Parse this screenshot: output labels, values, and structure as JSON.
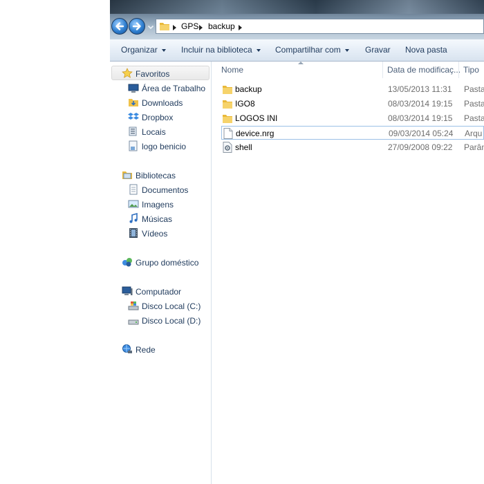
{
  "address_bar": {
    "breadcrumbs": [
      "GPS",
      "backup"
    ]
  },
  "toolbar": {
    "organize": "Organizar",
    "include_library": "Incluir na biblioteca",
    "share": "Compartilhar com",
    "burn": "Gravar",
    "new_folder": "Nova pasta"
  },
  "sidebar": {
    "favorites": {
      "label": "Favoritos",
      "items": [
        "Área de Trabalho",
        "Downloads",
        "Dropbox",
        "Locais",
        "logo benicio"
      ]
    },
    "libraries": {
      "label": "Bibliotecas",
      "items": [
        "Documentos",
        "Imagens",
        "Músicas",
        "Vídeos"
      ]
    },
    "homegroup": "Grupo doméstico",
    "computer": {
      "label": "Computador",
      "items": [
        "Disco Local (C:)",
        "Disco Local (D:)"
      ]
    },
    "network": "Rede"
  },
  "columns": {
    "name": "Nome",
    "date": "Data de modificaç...",
    "type": "Tipo"
  },
  "files": [
    {
      "name": "backup",
      "date": "13/05/2013 11:31",
      "type": "Pasta",
      "icon": "folder-icon"
    },
    {
      "name": "IGO8",
      "date": "08/03/2014 19:15",
      "type": "Pasta",
      "icon": "folder-icon"
    },
    {
      "name": "LOGOS INI",
      "date": "08/03/2014 19:15",
      "type": "Pasta",
      "icon": "folder-icon"
    },
    {
      "name": "device.nrg",
      "date": "09/03/2014 05:24",
      "type": "Arqu",
      "icon": "document-icon",
      "selected": true
    },
    {
      "name": "shell",
      "date": "27/09/2008 09:22",
      "type": "Parâm",
      "icon": "settings-file-icon"
    }
  ],
  "colors": {
    "text_blue": "#1e395b",
    "folder_yellow": "#f0c24a",
    "selection_border": "#9bc0e6"
  }
}
